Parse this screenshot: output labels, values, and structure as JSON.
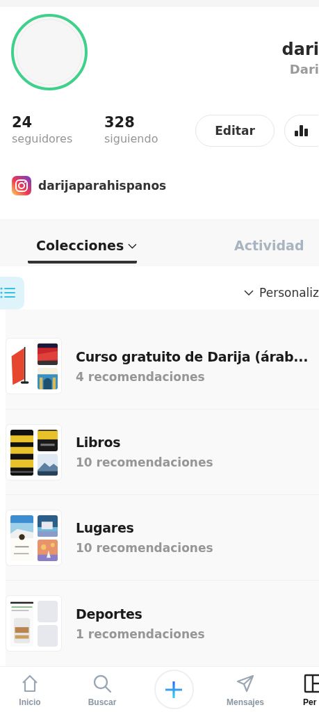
{
  "profile": {
    "name": "dari",
    "display_name": "Dari",
    "followers": {
      "count": "24",
      "label": "seguidores"
    },
    "following": {
      "count": "328",
      "label": "siguiendo"
    },
    "edit_button": "Editar",
    "instagram": "darijaparahispanos"
  },
  "tabs": [
    {
      "label": "Colecciones",
      "selected": true,
      "dropdown": true
    },
    {
      "label": "Actividad",
      "selected": false,
      "dropdown": false
    }
  ],
  "toolbar": {
    "list_view": true,
    "sort": "Personaliz"
  },
  "collections": [
    {
      "title": "Curso gratuito de Darija (árab...",
      "count": "4 recomendaciones",
      "tiles": [
        {
          "kind": "picture"
        },
        {
          "kind": "picture"
        },
        {
          "kind": "picture"
        }
      ]
    },
    {
      "title": "Libros",
      "count": "10 recomendaciones",
      "tiles": [
        {
          "kind": "picture"
        },
        {
          "kind": "picture"
        },
        {
          "kind": "picture"
        }
      ]
    },
    {
      "title": "Lugares",
      "count": "10 recomendaciones",
      "tiles": [
        {
          "kind": "picture"
        },
        {
          "kind": "picture"
        },
        {
          "kind": "picture"
        }
      ]
    },
    {
      "title": "Deportes",
      "count": "1 recomendaciones",
      "tiles": [
        {
          "kind": "picture"
        },
        {
          "kind": "empty"
        },
        {
          "kind": "empty"
        }
      ]
    }
  ],
  "nav": [
    {
      "kind": "home",
      "label": "Inicio",
      "selected": false
    },
    {
      "kind": "search",
      "label": "Buscar",
      "selected": false
    },
    {
      "kind": "add",
      "selected": false
    },
    {
      "kind": "send",
      "label": "Mensajes",
      "selected": false
    },
    {
      "kind": "profile",
      "label": "Per",
      "selected": true
    }
  ]
}
